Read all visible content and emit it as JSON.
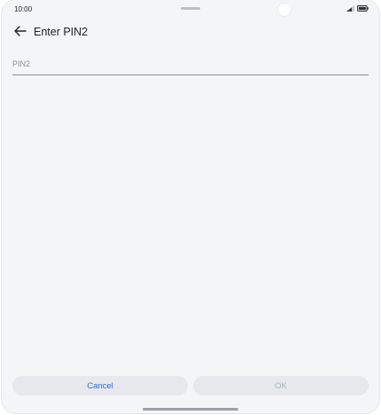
{
  "status_bar": {
    "time": "10:00",
    "icons": [
      "signal-icon",
      "battery-icon"
    ]
  },
  "header": {
    "back_icon": "arrow-left-icon",
    "title": "Enter PIN2"
  },
  "pin_input": {
    "placeholder": "PIN2",
    "value": ""
  },
  "actions": {
    "cancel_label": "Cancel",
    "ok_label": "OK"
  },
  "colors": {
    "accent": "#2f6bd9",
    "disabled_text": "#a9b3c7",
    "background": "#f4f5f7",
    "button_bg": "#e7e8eb"
  }
}
